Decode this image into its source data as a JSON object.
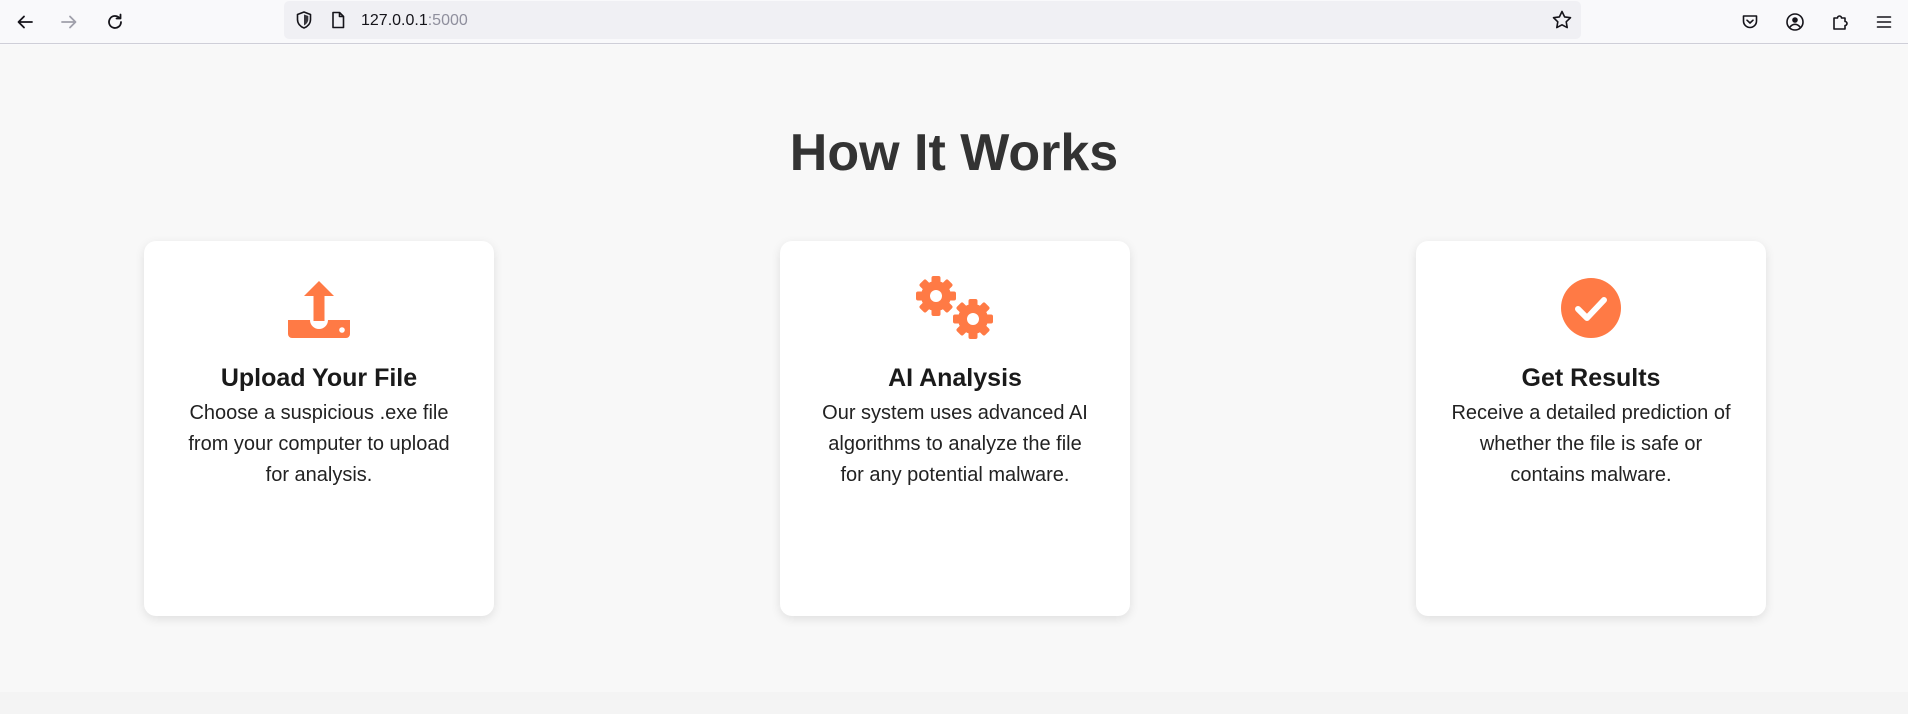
{
  "browser": {
    "url_host": "127.0.0.1",
    "url_port": ":5000",
    "icons": {
      "back": "arrow-left-icon",
      "forward": "arrow-right-icon",
      "reload": "reload-icon",
      "tracking": "shield-icon",
      "page_info": "page-icon",
      "bookmark": "star-icon",
      "pocket": "pocket-icon",
      "account": "account-icon",
      "extensions": "puzzle-icon",
      "menu": "hamburger-menu-icon"
    }
  },
  "main": {
    "heading": "How It Works",
    "accent_color": "#ff7a45",
    "cards": [
      {
        "icon": "upload-icon",
        "title": "Upload Your File",
        "description": "Choose a suspicious .exe file from your computer to upload for analysis."
      },
      {
        "icon": "gears-icon",
        "title": "AI Analysis",
        "description": "Our system uses advanced AI algorithms to analyze the file for any potential malware."
      },
      {
        "icon": "check-circle-icon",
        "title": "Get Results",
        "description": "Receive a detailed prediction of whether the file is safe or contains malware."
      }
    ]
  }
}
